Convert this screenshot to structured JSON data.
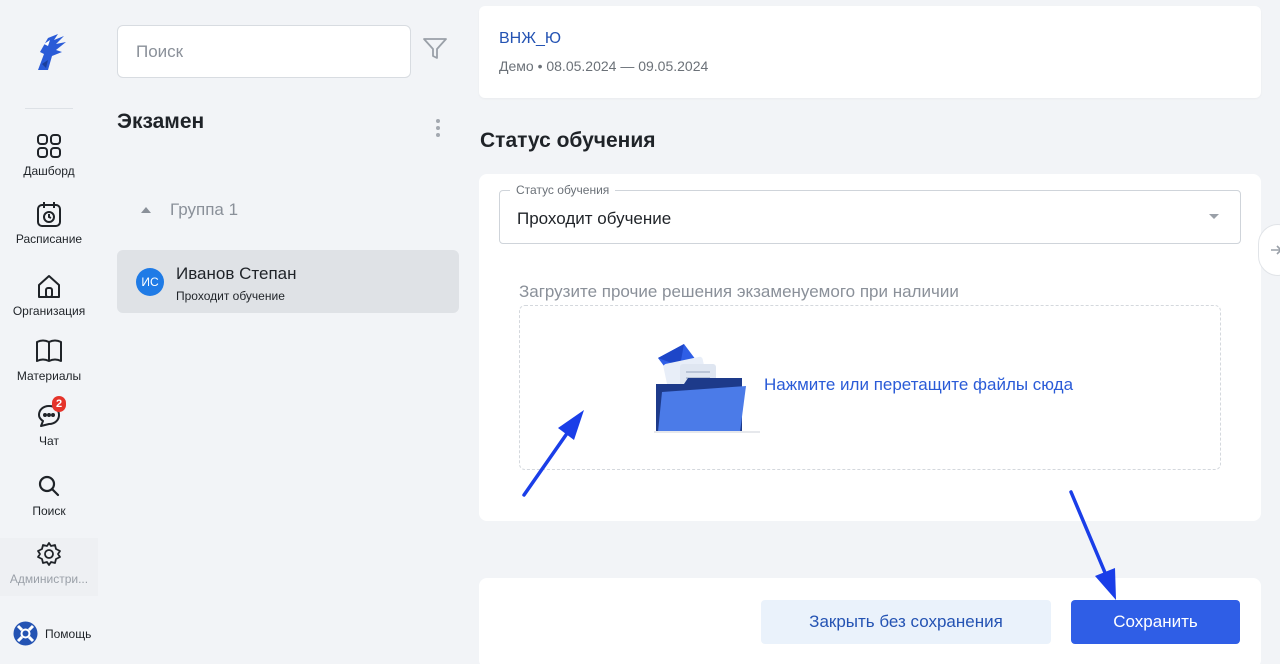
{
  "search": {
    "placeholder": "Поиск"
  },
  "nav": {
    "items": [
      {
        "label": "Дашборд",
        "icon": "dashboard-icon"
      },
      {
        "label": "Расписание",
        "icon": "calendar-icon"
      },
      {
        "label": "Организация",
        "icon": "organization-icon"
      },
      {
        "label": "Материалы",
        "icon": "book-icon"
      },
      {
        "label": "Чат",
        "icon": "chat-icon",
        "badge": "2"
      },
      {
        "label": "Поиск",
        "icon": "search-icon"
      },
      {
        "label": "Администри...",
        "icon": "gear-icon"
      }
    ],
    "help_label": "Помощь"
  },
  "exam": {
    "title": "Экзамен",
    "group_label": "Группа 1",
    "student": {
      "initials": "ИС",
      "name": "Иванов Степан",
      "status": "Проходит обучение"
    }
  },
  "course": {
    "title": "ВНЖ_Ю",
    "subtitle": "Демо • 08.05.2024 — 09.05.2024"
  },
  "training_status": {
    "section_title": "Статус обучения",
    "field_label": "Статус обучения",
    "value": "Проходит обучение",
    "upload_label": "Загрузите прочие решения экзаменуемого при наличии",
    "dropzone_text": "Нажмите или перетащите файлы сюда"
  },
  "actions": {
    "cancel_label": "Закрыть без сохранения",
    "save_label": "Сохранить"
  },
  "colors": {
    "accent": "#2f5ee6",
    "link": "#2453b3",
    "badge": "#e5332a",
    "avatar": "#1f7be6",
    "annotation_arrow": "#1a3ee8"
  }
}
